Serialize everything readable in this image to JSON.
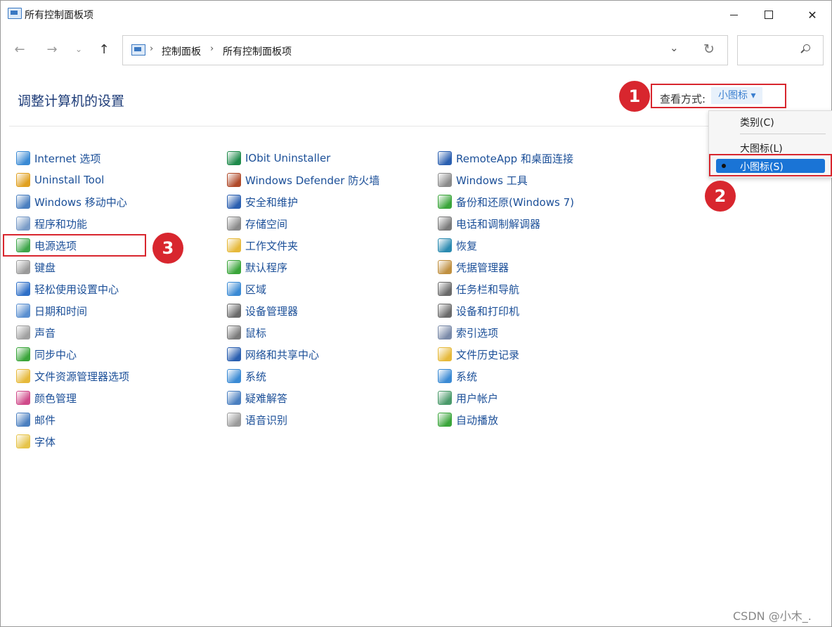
{
  "window": {
    "title": "所有控制面板项",
    "controls": {
      "minimize": "minimize",
      "maximize": "maximize",
      "close": "close"
    }
  },
  "nav": {
    "breadcrumb": [
      "控制面板",
      "所有控制面板项"
    ]
  },
  "page": {
    "heading": "调整计算机的设置"
  },
  "view_by": {
    "label": "查看方式:",
    "value": "小图标 ▾"
  },
  "view_menu": {
    "items": [
      "类别(C)",
      "大图标(L)",
      "小图标(S)"
    ],
    "selected": "小图标(S)"
  },
  "badges": [
    "1",
    "2",
    "3"
  ],
  "items": {
    "column1": [
      {
        "label": "Internet 选项",
        "icon": "globe-icon",
        "color": "#3a8ad4"
      },
      {
        "label": "Uninstall Tool",
        "icon": "uninstall-icon",
        "color": "#e0a020"
      },
      {
        "label": "Windows 移动中心",
        "icon": "mobility-icon",
        "color": "#4a7fc0"
      },
      {
        "label": "程序和功能",
        "icon": "programs-icon",
        "color": "#7a9cc8"
      },
      {
        "label": "电源选项",
        "icon": "power-icon",
        "color": "#3ea64a"
      },
      {
        "label": "键盘",
        "icon": "keyboard-icon",
        "color": "#9a9a9a"
      },
      {
        "label": "轻松使用设置中心",
        "icon": "ease-of-access-icon",
        "color": "#2e6fc7"
      },
      {
        "label": "日期和时间",
        "icon": "clock-icon",
        "color": "#5a8fd0"
      },
      {
        "label": "声音",
        "icon": "speaker-icon",
        "color": "#a0a0a0"
      },
      {
        "label": "同步中心",
        "icon": "sync-icon",
        "color": "#3aa53a"
      },
      {
        "label": "文件资源管理器选项",
        "icon": "folder-options-icon",
        "color": "#e6b93a"
      },
      {
        "label": "颜色管理",
        "icon": "color-management-icon",
        "color": "#d04a8a"
      },
      {
        "label": "邮件",
        "icon": "mail-icon",
        "color": "#4a7fc0"
      },
      {
        "label": "字体",
        "icon": "fonts-icon",
        "color": "#e6c44a"
      }
    ],
    "column2": [
      {
        "label": "IObit Uninstaller",
        "icon": "iobit-icon",
        "color": "#1e8a4a"
      },
      {
        "label": "Windows Defender 防火墙",
        "icon": "firewall-icon",
        "color": "#b04a2a"
      },
      {
        "label": "安全和维护",
        "icon": "flag-icon",
        "color": "#2a5fb0"
      },
      {
        "label": "存储空间",
        "icon": "storage-icon",
        "color": "#8a8a8a"
      },
      {
        "label": "工作文件夹",
        "icon": "work-folders-icon",
        "color": "#e6b93a"
      },
      {
        "label": "默认程序",
        "icon": "default-programs-icon",
        "color": "#3aa53a"
      },
      {
        "label": "区域",
        "icon": "region-icon",
        "color": "#3a8ad4"
      },
      {
        "label": "设备管理器",
        "icon": "device-manager-icon",
        "color": "#6a6a6a"
      },
      {
        "label": "鼠标",
        "icon": "mouse-icon",
        "color": "#7a7a7a"
      },
      {
        "label": "网络和共享中心",
        "icon": "network-icon",
        "color": "#2a5fb0"
      },
      {
        "label": "系统",
        "icon": "system-icon",
        "color": "#3a8ad4"
      },
      {
        "label": "疑难解答",
        "icon": "troubleshoot-icon",
        "color": "#4a7fc0"
      },
      {
        "label": "语音识别",
        "icon": "microphone-icon",
        "color": "#9a9a9a"
      }
    ],
    "column3": [
      {
        "label": "RemoteApp 和桌面连接",
        "icon": "remoteapp-icon",
        "color": "#2a5fb0"
      },
      {
        "label": "Windows 工具",
        "icon": "tools-icon",
        "color": "#8a8a8a"
      },
      {
        "label": "备份和还原(Windows 7)",
        "icon": "backup-icon",
        "color": "#3aa53a"
      },
      {
        "label": "电话和调制解调器",
        "icon": "phone-icon",
        "color": "#7a7a7a"
      },
      {
        "label": "恢复",
        "icon": "recovery-icon",
        "color": "#2a8ab0"
      },
      {
        "label": "凭据管理器",
        "icon": "credential-icon",
        "color": "#c09040"
      },
      {
        "label": "任务栏和导航",
        "icon": "taskbar-icon",
        "color": "#6a6a6a"
      },
      {
        "label": "设备和打印机",
        "icon": "printer-icon",
        "color": "#6a6a6a"
      },
      {
        "label": "索引选项",
        "icon": "indexing-icon",
        "color": "#7a8aa8"
      },
      {
        "label": "文件历史记录",
        "icon": "file-history-icon",
        "color": "#e6b93a"
      },
      {
        "label": "系统",
        "icon": "system-icon",
        "color": "#3a8ad4"
      },
      {
        "label": "用户帐户",
        "icon": "user-accounts-icon",
        "color": "#4a9a6a"
      },
      {
        "label": "自动播放",
        "icon": "autoplay-icon",
        "color": "#3aa53a"
      }
    ]
  },
  "watermark": "CSDN @小木_."
}
